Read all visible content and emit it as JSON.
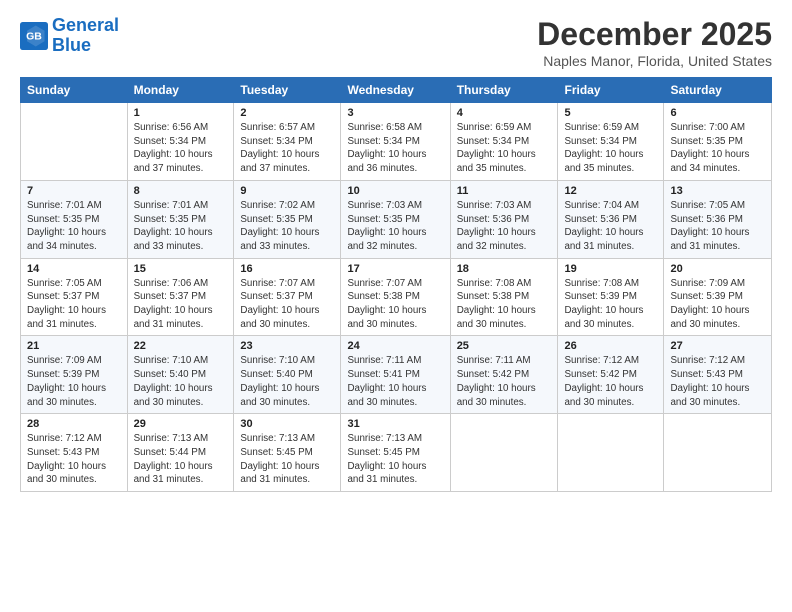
{
  "header": {
    "logo_line1": "General",
    "logo_line2": "Blue",
    "month_title": "December 2025",
    "location": "Naples Manor, Florida, United States"
  },
  "weekdays": [
    "Sunday",
    "Monday",
    "Tuesday",
    "Wednesday",
    "Thursday",
    "Friday",
    "Saturday"
  ],
  "weeks": [
    [
      {
        "day": "",
        "sunrise": "",
        "sunset": "",
        "daylight": ""
      },
      {
        "day": "1",
        "sunrise": "Sunrise: 6:56 AM",
        "sunset": "Sunset: 5:34 PM",
        "daylight": "Daylight: 10 hours and 37 minutes."
      },
      {
        "day": "2",
        "sunrise": "Sunrise: 6:57 AM",
        "sunset": "Sunset: 5:34 PM",
        "daylight": "Daylight: 10 hours and 37 minutes."
      },
      {
        "day": "3",
        "sunrise": "Sunrise: 6:58 AM",
        "sunset": "Sunset: 5:34 PM",
        "daylight": "Daylight: 10 hours and 36 minutes."
      },
      {
        "day": "4",
        "sunrise": "Sunrise: 6:59 AM",
        "sunset": "Sunset: 5:34 PM",
        "daylight": "Daylight: 10 hours and 35 minutes."
      },
      {
        "day": "5",
        "sunrise": "Sunrise: 6:59 AM",
        "sunset": "Sunset: 5:34 PM",
        "daylight": "Daylight: 10 hours and 35 minutes."
      },
      {
        "day": "6",
        "sunrise": "Sunrise: 7:00 AM",
        "sunset": "Sunset: 5:35 PM",
        "daylight": "Daylight: 10 hours and 34 minutes."
      }
    ],
    [
      {
        "day": "7",
        "sunrise": "Sunrise: 7:01 AM",
        "sunset": "Sunset: 5:35 PM",
        "daylight": "Daylight: 10 hours and 34 minutes."
      },
      {
        "day": "8",
        "sunrise": "Sunrise: 7:01 AM",
        "sunset": "Sunset: 5:35 PM",
        "daylight": "Daylight: 10 hours and 33 minutes."
      },
      {
        "day": "9",
        "sunrise": "Sunrise: 7:02 AM",
        "sunset": "Sunset: 5:35 PM",
        "daylight": "Daylight: 10 hours and 33 minutes."
      },
      {
        "day": "10",
        "sunrise": "Sunrise: 7:03 AM",
        "sunset": "Sunset: 5:35 PM",
        "daylight": "Daylight: 10 hours and 32 minutes."
      },
      {
        "day": "11",
        "sunrise": "Sunrise: 7:03 AM",
        "sunset": "Sunset: 5:36 PM",
        "daylight": "Daylight: 10 hours and 32 minutes."
      },
      {
        "day": "12",
        "sunrise": "Sunrise: 7:04 AM",
        "sunset": "Sunset: 5:36 PM",
        "daylight": "Daylight: 10 hours and 31 minutes."
      },
      {
        "day": "13",
        "sunrise": "Sunrise: 7:05 AM",
        "sunset": "Sunset: 5:36 PM",
        "daylight": "Daylight: 10 hours and 31 minutes."
      }
    ],
    [
      {
        "day": "14",
        "sunrise": "Sunrise: 7:05 AM",
        "sunset": "Sunset: 5:37 PM",
        "daylight": "Daylight: 10 hours and 31 minutes."
      },
      {
        "day": "15",
        "sunrise": "Sunrise: 7:06 AM",
        "sunset": "Sunset: 5:37 PM",
        "daylight": "Daylight: 10 hours and 31 minutes."
      },
      {
        "day": "16",
        "sunrise": "Sunrise: 7:07 AM",
        "sunset": "Sunset: 5:37 PM",
        "daylight": "Daylight: 10 hours and 30 minutes."
      },
      {
        "day": "17",
        "sunrise": "Sunrise: 7:07 AM",
        "sunset": "Sunset: 5:38 PM",
        "daylight": "Daylight: 10 hours and 30 minutes."
      },
      {
        "day": "18",
        "sunrise": "Sunrise: 7:08 AM",
        "sunset": "Sunset: 5:38 PM",
        "daylight": "Daylight: 10 hours and 30 minutes."
      },
      {
        "day": "19",
        "sunrise": "Sunrise: 7:08 AM",
        "sunset": "Sunset: 5:39 PM",
        "daylight": "Daylight: 10 hours and 30 minutes."
      },
      {
        "day": "20",
        "sunrise": "Sunrise: 7:09 AM",
        "sunset": "Sunset: 5:39 PM",
        "daylight": "Daylight: 10 hours and 30 minutes."
      }
    ],
    [
      {
        "day": "21",
        "sunrise": "Sunrise: 7:09 AM",
        "sunset": "Sunset: 5:39 PM",
        "daylight": "Daylight: 10 hours and 30 minutes."
      },
      {
        "day": "22",
        "sunrise": "Sunrise: 7:10 AM",
        "sunset": "Sunset: 5:40 PM",
        "daylight": "Daylight: 10 hours and 30 minutes."
      },
      {
        "day": "23",
        "sunrise": "Sunrise: 7:10 AM",
        "sunset": "Sunset: 5:40 PM",
        "daylight": "Daylight: 10 hours and 30 minutes."
      },
      {
        "day": "24",
        "sunrise": "Sunrise: 7:11 AM",
        "sunset": "Sunset: 5:41 PM",
        "daylight": "Daylight: 10 hours and 30 minutes."
      },
      {
        "day": "25",
        "sunrise": "Sunrise: 7:11 AM",
        "sunset": "Sunset: 5:42 PM",
        "daylight": "Daylight: 10 hours and 30 minutes."
      },
      {
        "day": "26",
        "sunrise": "Sunrise: 7:12 AM",
        "sunset": "Sunset: 5:42 PM",
        "daylight": "Daylight: 10 hours and 30 minutes."
      },
      {
        "day": "27",
        "sunrise": "Sunrise: 7:12 AM",
        "sunset": "Sunset: 5:43 PM",
        "daylight": "Daylight: 10 hours and 30 minutes."
      }
    ],
    [
      {
        "day": "28",
        "sunrise": "Sunrise: 7:12 AM",
        "sunset": "Sunset: 5:43 PM",
        "daylight": "Daylight: 10 hours and 30 minutes."
      },
      {
        "day": "29",
        "sunrise": "Sunrise: 7:13 AM",
        "sunset": "Sunset: 5:44 PM",
        "daylight": "Daylight: 10 hours and 31 minutes."
      },
      {
        "day": "30",
        "sunrise": "Sunrise: 7:13 AM",
        "sunset": "Sunset: 5:45 PM",
        "daylight": "Daylight: 10 hours and 31 minutes."
      },
      {
        "day": "31",
        "sunrise": "Sunrise: 7:13 AM",
        "sunset": "Sunset: 5:45 PM",
        "daylight": "Daylight: 10 hours and 31 minutes."
      },
      {
        "day": "",
        "sunrise": "",
        "sunset": "",
        "daylight": ""
      },
      {
        "day": "",
        "sunrise": "",
        "sunset": "",
        "daylight": ""
      },
      {
        "day": "",
        "sunrise": "",
        "sunset": "",
        "daylight": ""
      }
    ]
  ]
}
